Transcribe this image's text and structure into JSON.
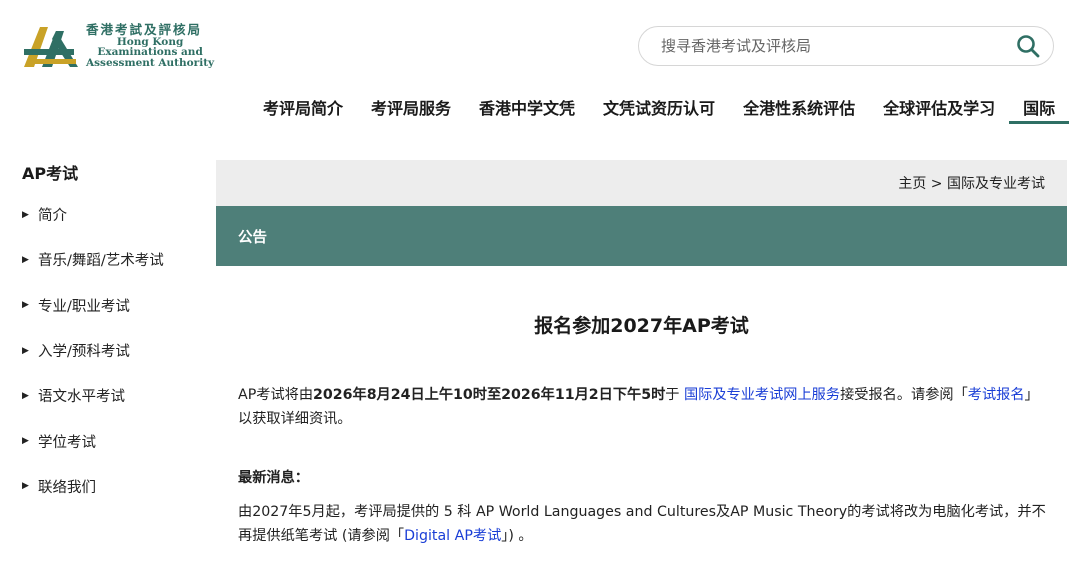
{
  "logo": {
    "cn": "香港考試及評核局",
    "en_line1": "Hong Kong",
    "en_line2": "Examinations and",
    "en_line3": "Assessment Authority"
  },
  "search": {
    "placeholder": "搜寻香港考试及评核局"
  },
  "nav": {
    "items": [
      "考评局简介",
      "考评局服务",
      "香港中学文凭",
      "文凭试资历认可",
      "全港性系统评估",
      "全球评估及学习",
      "国际"
    ]
  },
  "sidebar": {
    "title": "AP考试",
    "items": [
      "简介",
      "音乐/舞蹈/艺术考试",
      "专业/职业考试",
      "入学/预科考试",
      "语文水平考试",
      "学位考试",
      "联络我们"
    ]
  },
  "breadcrumb": {
    "text": "主页 > 国际及专业考试"
  },
  "banner": {
    "label": "公告"
  },
  "article": {
    "title": "报名参加2027年AP考试",
    "p1_a": "AP考试将由",
    "p1_b": "2026年8月24日上午10时至2026年11月2日下午5时",
    "p1_c": "于 ",
    "p1_link1": "国际及专业考试网上服务",
    "p1_d": "接受报名。请参阅「",
    "p1_link2": "考试报名",
    "p1_e": "」以获取详细资讯。",
    "news_heading": "最新消息：",
    "p3_a": "由2027年5月起，考评局提供的 5 科 AP World Languages and Cultures及AP Music Theory的考试将改为电脑化考试，并不再提供纸笔考试 (请参阅「",
    "p3_link": "Digital AP考试",
    "p3_b": "」) 。"
  },
  "colors": {
    "accent": "#4e7f79",
    "link": "#1a3ed6",
    "breadcrumb_bg": "#ededed"
  }
}
